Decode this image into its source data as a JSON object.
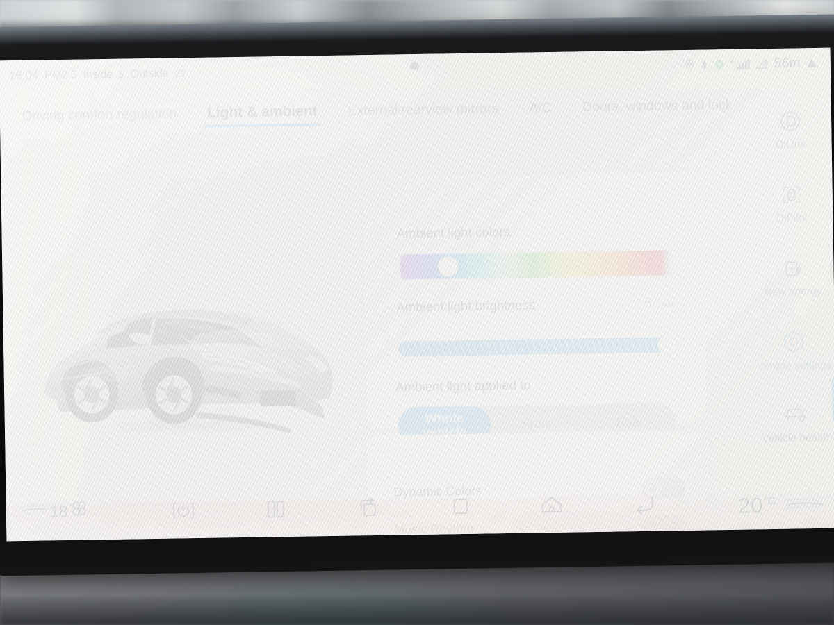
{
  "status_bar": {
    "time": "16:04",
    "pm_label": "PM2.5",
    "inside_label": "Inside",
    "inside_value": "5",
    "outside_label": "Outside",
    "outside_value": "22",
    "network": "4G",
    "altitude": "56m",
    "icons": [
      "location-pin-icon",
      "bluetooth-icon",
      "green-status-icon",
      "signal-bars-icon",
      "altitude-icon",
      "notification-icon"
    ]
  },
  "tabs": [
    {
      "label": "Driving comfort regulation",
      "active": false
    },
    {
      "label": "Light & ambient",
      "active": true
    },
    {
      "label": "External rearview mirrors",
      "active": false
    },
    {
      "label": "A/C",
      "active": false
    },
    {
      "label": "Doors, windows and lock",
      "active": false
    }
  ],
  "settings": {
    "color_section_label": "Ambient light colors",
    "brightness_section_label": "Ambient light brightness",
    "brightness_value": "5",
    "brightness_unit": "Gear",
    "applied_to_label": "Ambient light applied to",
    "segments": [
      {
        "line1": "Whole",
        "line2": "vehicle",
        "selected": true
      },
      {
        "label": "Front",
        "selected": false
      },
      {
        "label": "Rear",
        "selected": false
      }
    ],
    "toggles": [
      {
        "label": "Dynamic Colors",
        "on": false
      },
      {
        "label": "Music Rhythm",
        "on": false
      }
    ]
  },
  "colors": {
    "accent_blue": "#1f93ef",
    "active_tab_underline": "#2094e8",
    "rail_active": "#2b9ae0",
    "gear_text": "#86a8c4",
    "segment_track": "#c7cacc",
    "toggle_off_track": "#c6c9cb"
  },
  "rail": [
    {
      "label": "DiLink",
      "icon": "dilink-icon",
      "active": false
    },
    {
      "label": "DiPilot",
      "icon": "dipilot-icon",
      "active": false
    },
    {
      "label": "New energy",
      "icon": "charging-station-icon",
      "active": false
    },
    {
      "label": "Vehicle settings",
      "icon": "hex-gear-icon",
      "active": true
    },
    {
      "label": "Vehicle health",
      "icon": "car-heart-icon",
      "active": false
    }
  ],
  "bottom_bar": {
    "fan_speed": "18",
    "temperature": "20",
    "temperature_unit": "°C",
    "nav_icons": [
      "power-icon",
      "split-screen-icon",
      "rotate-screen-icon",
      "recents-icon",
      "home-icon",
      "back-icon"
    ]
  }
}
